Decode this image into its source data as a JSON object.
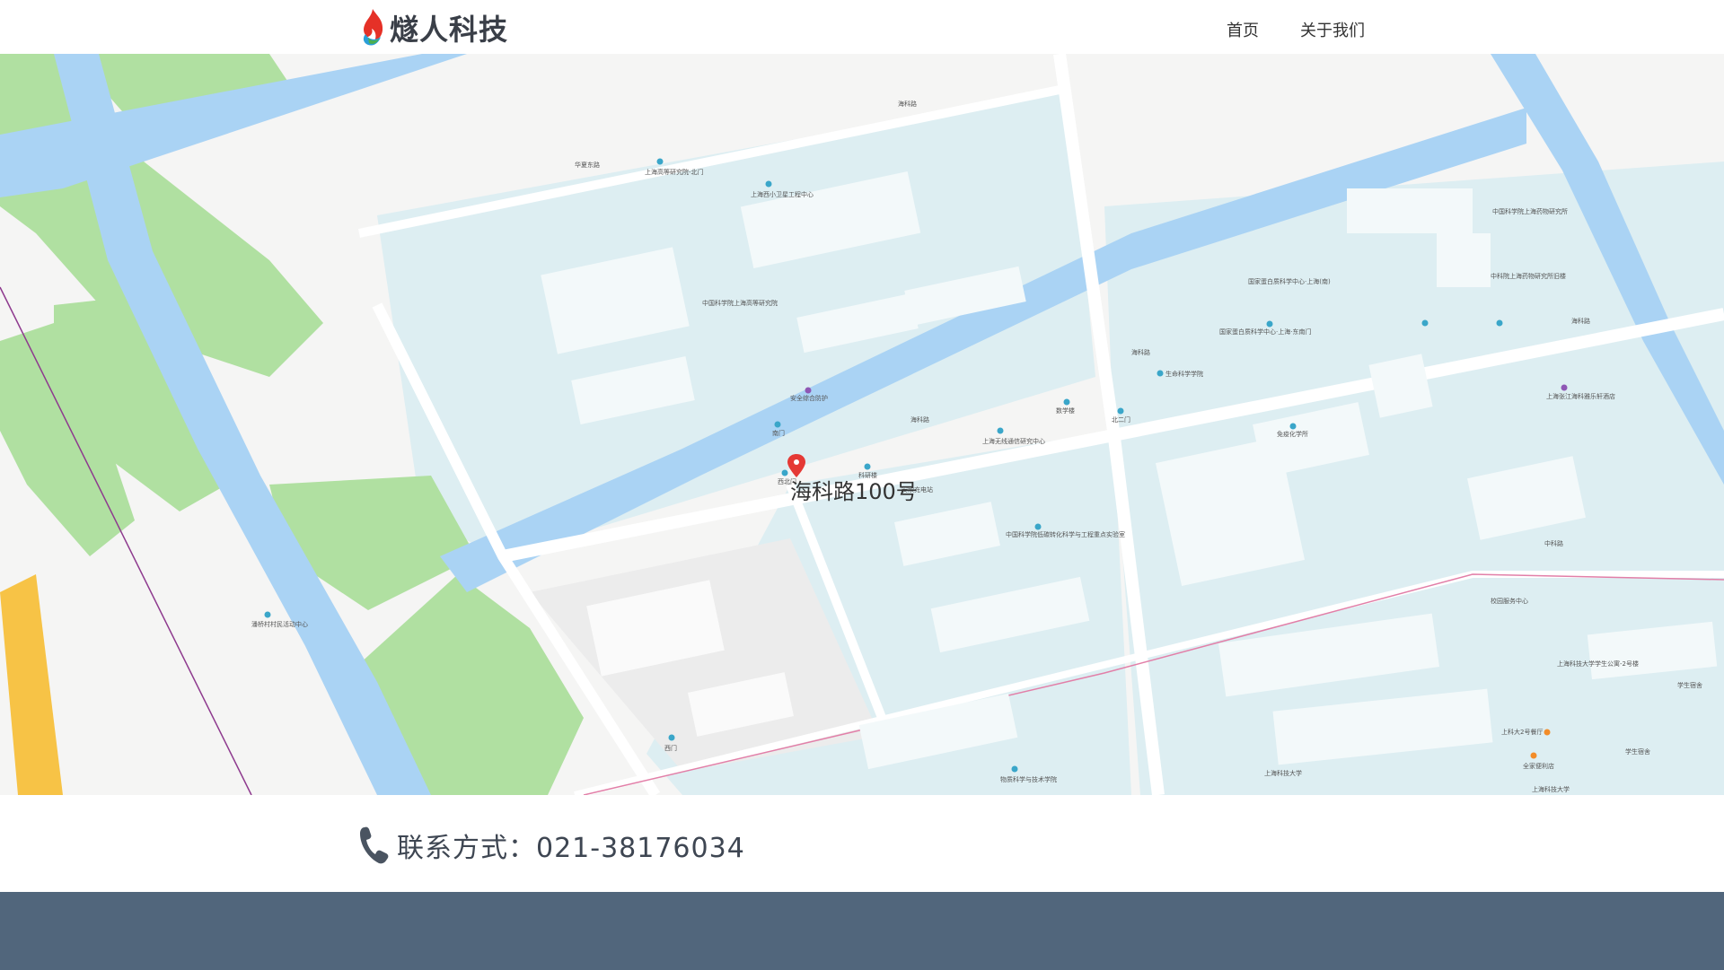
{
  "header": {
    "brand": "燧人科技",
    "nav": [
      {
        "label": "首页"
      },
      {
        "label": "关于我们"
      }
    ]
  },
  "map": {
    "marker_label": "海科路100号",
    "road_labels": [
      "海科路",
      "海科路",
      "海科路",
      "海科路",
      "中科路",
      "华夏东路"
    ],
    "pois": [
      "上海高等研究院-北门",
      "上海西小卫星工程中心",
      "中国科学院上海高等研究院",
      "安全综合防护",
      "南门",
      "西北门",
      "科研楼",
      "安欣充电站",
      "上海无线通信研究中心",
      "中国科学院低碳转化科学与工程重点实验室",
      "数学楼",
      "北二门",
      "生命科学学院",
      "国家蛋白质科学中心·上海(南)",
      "国家蛋白质科学中心·上海·东南门",
      "中国科学院上海药物研究所",
      "中科院上海药物研究所旧楼",
      "免疫化学所",
      "上海张江海科雅乐轩酒店",
      "校园服务中心",
      "上海科技大学学生公寓-2号楼",
      "学生宿舍",
      "学生宿舍",
      "上科大2号餐厅",
      "全家便利店",
      "上海科技大学",
      "上海科技大学",
      "物质科学与技术学院",
      "西门",
      "潘桥村村民活动中心"
    ],
    "colors": {
      "water": "#aad3f4",
      "green": "#b0e0a1",
      "campus": "#ddeef2",
      "road": "#ffffff",
      "marker": "#e53935"
    }
  },
  "contact": {
    "icon": "phone-icon",
    "text": "联系方式：021-38176034"
  },
  "footer": {
    "color": "#51667c"
  }
}
